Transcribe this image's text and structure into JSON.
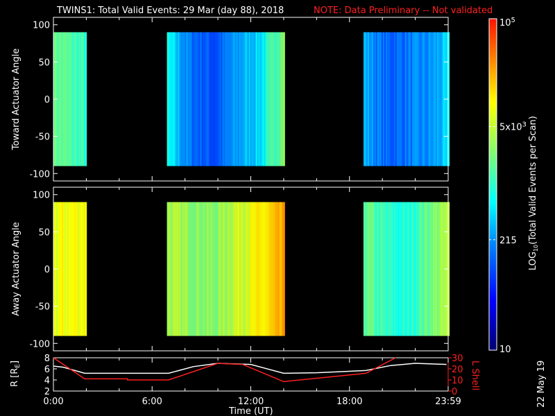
{
  "title": "TWINS1: Total Valid Events: 29 Mar (day  88), 2018",
  "note": "NOTE: Data Preliminary -- Not validated",
  "date_stamp": "22 May 19",
  "colors": {
    "note": "#ff2020",
    "r_line": "#ffffff",
    "l_line": "#ff2020"
  },
  "chart_data": [
    {
      "type": "heatmap",
      "name": "toward",
      "ylabel": "Toward Actuator Angle",
      "ylim": [
        -110,
        110
      ],
      "yticks": [
        "100",
        "50",
        "0",
        "-50",
        "-100"
      ],
      "ytick_values": [
        100,
        50,
        0,
        -50,
        -100
      ],
      "angle_range": [
        -90,
        90
      ],
      "blocks": [
        {
          "start_hr": 0,
          "end_hr": 1.95,
          "log_level": [
            3.3,
            3.0
          ]
        },
        {
          "start_hr": 6.9,
          "end_hr": 14.0,
          "log_level": [
            2.8,
            2.2,
            2.0,
            2.4,
            2.7,
            3.5
          ]
        },
        {
          "start_hr": 18.85,
          "end_hr": 24,
          "log_level": [
            2.5,
            2.1,
            2.2,
            2.3,
            2.6
          ]
        }
      ]
    },
    {
      "type": "heatmap",
      "name": "away",
      "ylabel": "Away Actuator Angle",
      "ylim": [
        -110,
        110
      ],
      "yticks": [
        "100",
        "50",
        "0",
        "-50",
        "-100"
      ],
      "ytick_values": [
        100,
        50,
        0,
        -50,
        -100
      ],
      "angle_range": [
        -90,
        90
      ],
      "blocks": [
        {
          "start_hr": 0,
          "end_hr": 1.95,
          "log_level": [
            3.9,
            4.0
          ]
        },
        {
          "start_hr": 6.9,
          "end_hr": 14.0,
          "log_level": [
            3.6,
            3.5,
            3.4,
            3.8,
            4.0,
            4.3
          ]
        },
        {
          "start_hr": 18.85,
          "end_hr": 24,
          "log_level": [
            3.3,
            3.0,
            2.9,
            3.3,
            3.6
          ]
        }
      ]
    },
    {
      "type": "line",
      "name": "orbit",
      "xlabel": "Time (UT)",
      "xticks": [
        "0:00",
        "6:00",
        "12:00",
        "18:00",
        "23:59"
      ],
      "xtick_values": [
        0,
        6,
        12,
        18,
        24
      ],
      "ylabel": "R [R",
      "ylabel_sub": "E",
      "ylabel_end": "]",
      "ylim": [
        2,
        8
      ],
      "yticks": [
        "8",
        "6",
        "4",
        "2"
      ],
      "ytick_values": [
        8,
        6,
        4,
        2
      ],
      "y2label": "L Shell",
      "y2lim": [
        0,
        30
      ],
      "y2ticks": [
        "30",
        "20",
        "10",
        "0"
      ],
      "y2tick_values": [
        30,
        20,
        10,
        0
      ],
      "series": [
        {
          "name": "R",
          "axis": "left",
          "x": [
            0,
            0.6,
            1.9,
            7,
            8.5,
            10,
            12,
            14,
            16,
            19,
            20.5,
            22,
            23.9
          ],
          "y": [
            6.5,
            6.3,
            5.2,
            5.2,
            6.4,
            7,
            6.8,
            5.2,
            5.3,
            5.7,
            6.6,
            7,
            6.8
          ]
        },
        {
          "name": "L Shell",
          "axis": "right",
          "x": [
            0,
            1.9,
            4.5,
            4.5,
            7,
            10,
            11.5,
            14,
            19,
            20.8
          ],
          "y": [
            30,
            11,
            11,
            10,
            10,
            25,
            24,
            8.5,
            16,
            31
          ]
        }
      ]
    },
    {
      "type": "colorbar",
      "label": "LOG",
      "label_sub": "10",
      "label_rest": "(Total Valid Events per Scan)",
      "range_log": [
        1,
        5
      ],
      "ticks": [
        {
          "label": "10",
          "value": 10
        },
        {
          "label": "215",
          "value": 215
        },
        {
          "label": "5x10",
          "sup": "3",
          "value": 5000
        },
        {
          "label": "10",
          "sup": "5",
          "value": 100000
        }
      ]
    }
  ]
}
